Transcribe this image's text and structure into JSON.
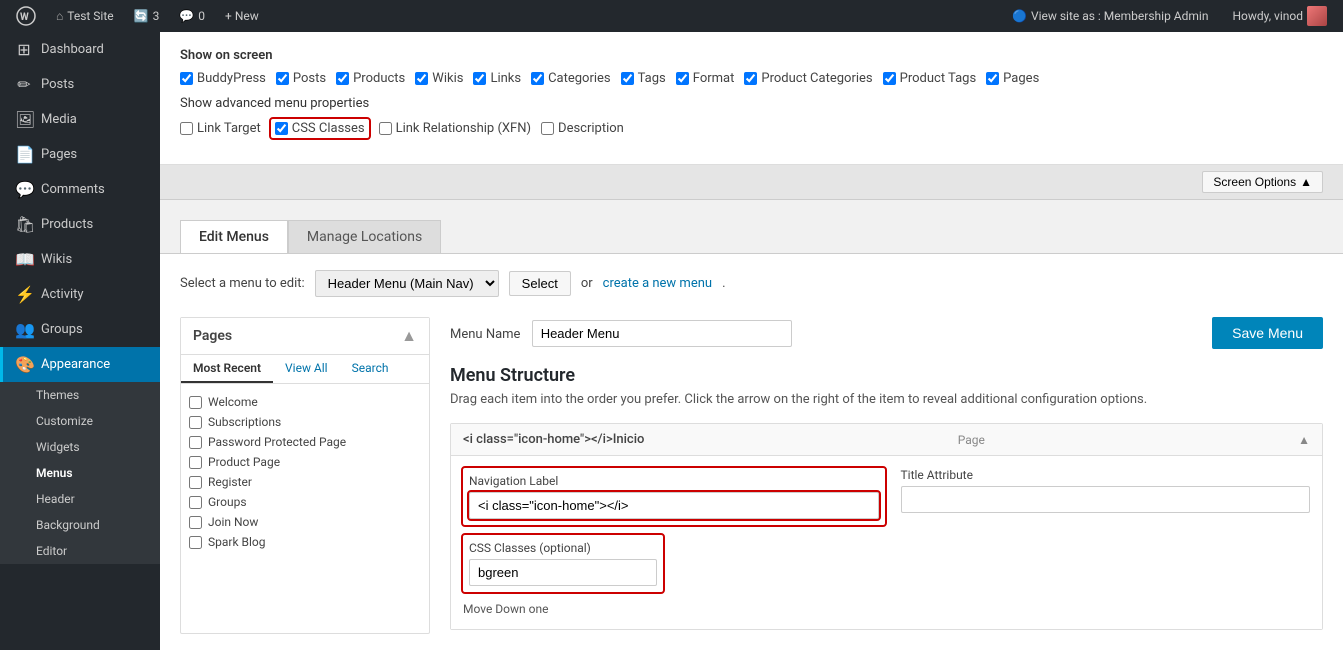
{
  "admin_bar": {
    "site_name": "Test Site",
    "updates_count": "3",
    "comments_count": "0",
    "new_label": "+ New",
    "view_site_label": "View site as : Membership Admin",
    "howdy_label": "Howdy, vinod"
  },
  "sidebar": {
    "items": [
      {
        "id": "dashboard",
        "label": "Dashboard",
        "icon": "⊞"
      },
      {
        "id": "posts",
        "label": "Posts",
        "icon": "📝"
      },
      {
        "id": "media",
        "label": "Media",
        "icon": "🖼"
      },
      {
        "id": "pages",
        "label": "Pages",
        "icon": "📄"
      },
      {
        "id": "comments",
        "label": "Comments",
        "icon": "💬"
      },
      {
        "id": "products",
        "label": "Products",
        "icon": "🛍"
      },
      {
        "id": "wikis",
        "label": "Wikis",
        "icon": "📖"
      },
      {
        "id": "activity",
        "label": "Activity",
        "icon": "⚡"
      },
      {
        "id": "groups",
        "label": "Groups",
        "icon": "👥"
      },
      {
        "id": "appearance",
        "label": "Appearance",
        "icon": "🎨"
      }
    ],
    "sub_items": [
      {
        "id": "themes",
        "label": "Themes"
      },
      {
        "id": "customize",
        "label": "Customize"
      },
      {
        "id": "widgets",
        "label": "Widgets"
      },
      {
        "id": "menus",
        "label": "Menus"
      },
      {
        "id": "header",
        "label": "Header"
      },
      {
        "id": "background",
        "label": "Background"
      },
      {
        "id": "editor",
        "label": "Editor"
      }
    ]
  },
  "screen_options": {
    "button_label": "Screen Options",
    "show_on_screen_label": "Show on screen",
    "checkboxes": [
      {
        "id": "buddypress",
        "label": "BuddyPress",
        "checked": true
      },
      {
        "id": "posts",
        "label": "Posts",
        "checked": true
      },
      {
        "id": "products",
        "label": "Products",
        "checked": true
      },
      {
        "id": "wikis",
        "label": "Wikis",
        "checked": true
      },
      {
        "id": "links",
        "label": "Links",
        "checked": true
      },
      {
        "id": "categories",
        "label": "Categories",
        "checked": true
      },
      {
        "id": "tags",
        "label": "Tags",
        "checked": true
      },
      {
        "id": "format",
        "label": "Format",
        "checked": true
      },
      {
        "id": "product_categories",
        "label": "Product Categories",
        "checked": true
      },
      {
        "id": "product_tags",
        "label": "Product Tags",
        "checked": true
      },
      {
        "id": "pages",
        "label": "Pages",
        "checked": true
      }
    ],
    "advanced_label": "Show advanced menu properties",
    "advanced_checkboxes": [
      {
        "id": "link_target",
        "label": "Link Target",
        "checked": false
      },
      {
        "id": "css_classes",
        "label": "CSS Classes",
        "checked": true,
        "highlighted": true
      },
      {
        "id": "link_relationship",
        "label": "Link Relationship (XFN)",
        "checked": false
      },
      {
        "id": "description",
        "label": "Description",
        "checked": false
      }
    ]
  },
  "tabs": [
    {
      "id": "edit_menus",
      "label": "Edit Menus",
      "active": true
    },
    {
      "id": "manage_locations",
      "label": "Manage Locations",
      "active": false
    }
  ],
  "select_menu": {
    "label": "Select a menu to edit:",
    "current_value": "Header Menu (Main Nav)",
    "select_button": "Select",
    "or_text": "or",
    "create_link_text": "create a new menu",
    "create_link_url": "#"
  },
  "pages_panel": {
    "title": "Pages",
    "tabs": [
      {
        "id": "most_recent",
        "label": "Most Recent",
        "active": true
      },
      {
        "id": "view_all",
        "label": "View All",
        "active": false
      },
      {
        "id": "search",
        "label": "Search",
        "active": false
      }
    ],
    "items": [
      {
        "id": "welcome",
        "label": "Welcome",
        "checked": false
      },
      {
        "id": "subscriptions",
        "label": "Subscriptions",
        "checked": false
      },
      {
        "id": "password_protected",
        "label": "Password Protected Page",
        "checked": false
      },
      {
        "id": "product_page",
        "label": "Product Page",
        "checked": false
      },
      {
        "id": "register",
        "label": "Register",
        "checked": false
      },
      {
        "id": "groups",
        "label": "Groups",
        "checked": false
      },
      {
        "id": "join_now",
        "label": "Join Now",
        "checked": false
      },
      {
        "id": "spark_blog",
        "label": "Spark Blog",
        "checked": false
      }
    ]
  },
  "menu_name": {
    "label": "Menu Name",
    "value": "Header Menu"
  },
  "save_menu_button": "Save Menu",
  "menu_structure": {
    "title": "Menu Structure",
    "description": "Drag each item into the order you prefer. Click the arrow on the right of the item to reveal additional configuration options.",
    "items": [
      {
        "id": "inicio",
        "label": "<i class=\"icon-home\"></i>Inicio",
        "type": "Page",
        "nav_label": "<i class=\"icon-home\"></i>",
        "title_attr": "",
        "css_classes": "bgreen"
      }
    ]
  },
  "menu_item_fields": {
    "nav_label_label": "Navigation Label",
    "title_attr_label": "Title Attribute",
    "css_classes_label": "CSS Classes (optional)",
    "move_down_label": "Move Down one"
  }
}
